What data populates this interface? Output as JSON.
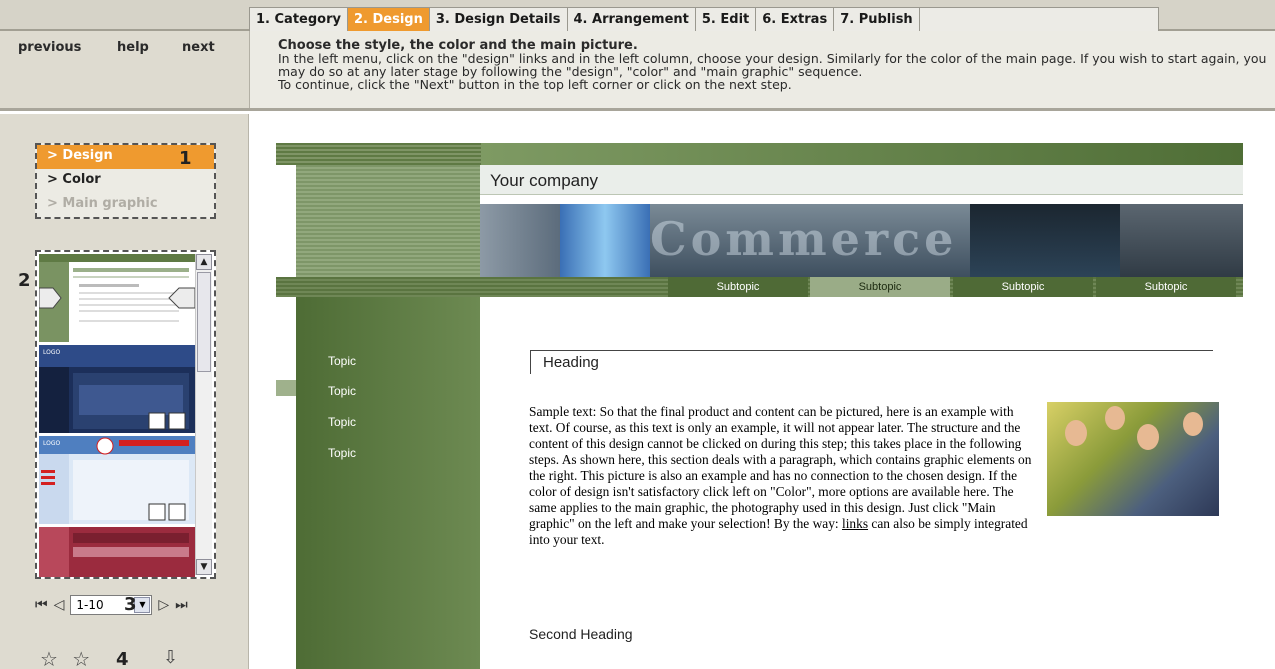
{
  "tabs": [
    {
      "label": "1. Category",
      "active": false
    },
    {
      "label": "2. Design",
      "active": true
    },
    {
      "label": "3. Design Details",
      "active": false
    },
    {
      "label": "4. Arrangement",
      "active": false
    },
    {
      "label": "5. Edit",
      "active": false
    },
    {
      "label": "6. Extras",
      "active": false
    },
    {
      "label": "7. Publish",
      "active": false
    }
  ],
  "nav": {
    "previous": "previous",
    "help": "help",
    "next": "next"
  },
  "instructions": {
    "title": "Choose the style, the color and the main picture.",
    "line1": "In the left menu, click on the \"design\" links and in the left column, choose your design. Similarly for the color of the main page. If you wish to start again, you may do so at any later stage by following the \"design\", \"color\" and \"main graphic\" sequence.",
    "line2": "To continue, click the \"Next\" button in the top left corner or click on the next step."
  },
  "left_menu": {
    "items": [
      "> Design",
      "> Color",
      "> Main graphic"
    ],
    "active_index": 0
  },
  "callouts": {
    "n1": "1",
    "n2": "2",
    "n3": "3",
    "n4": "4"
  },
  "pager": {
    "range": "1-10"
  },
  "accent_color": "#ef9a2f",
  "icons": [
    "first-page-icon",
    "prev-page-icon",
    "next-page-icon",
    "last-page-icon",
    "star-outline-icon",
    "star-outline-icon",
    "download-arrow-icon"
  ],
  "preview": {
    "company": "Your company",
    "banner_word": "Commerce",
    "subtopics": [
      "Subtopic",
      "Subtopic",
      "Subtopic",
      "Subtopic"
    ],
    "topics": [
      "Topic",
      "Topic",
      "Topic",
      "Topic"
    ],
    "heading": "Heading",
    "body_part1": "Sample text: So that the final product and content can be pictured, here is an example with text. Of course, as this text is only an example, it will not appear later. The structure and the content of this design cannot be clicked on during this step; this takes place in the following steps. As shown here, this section deals with a paragraph, which contains graphic elements on the right. This picture is also an example and has no connection to the chosen design. If the color of design isn't satisfactory click left on \"Color\", more options are available here. The same applies to the main graphic, the photography used in this design. Just click \"Main graphic\" on the left and make your selection! By the way: ",
    "link_text": "links",
    "body_part2": " can also be simply integrated into your text.",
    "second_heading": "Second Heading"
  }
}
